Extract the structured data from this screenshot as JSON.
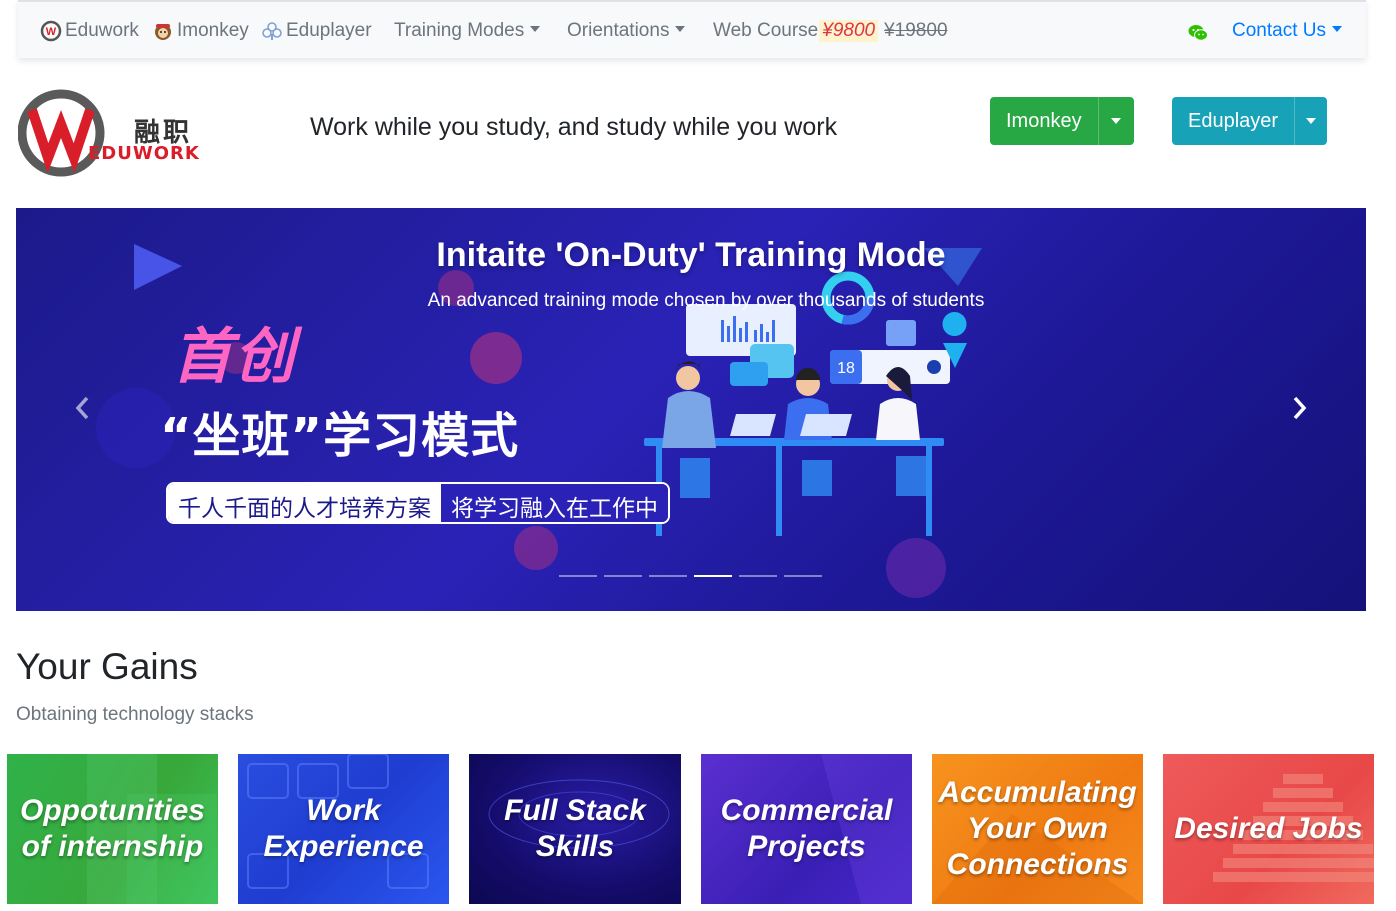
{
  "navbar": {
    "brand_items": [
      {
        "label": "Eduwork",
        "icon": "eduwork-logo-icon"
      },
      {
        "label": "Imonkey",
        "icon": "monkey-icon"
      },
      {
        "label": "Eduplayer",
        "icon": "eduplayer-icon"
      }
    ],
    "dropdowns": [
      "Training Modes",
      "Orientations"
    ],
    "web_course": {
      "label": "Web Course",
      "price_new": "¥9800",
      "price_old": "¥19800"
    },
    "wechat_icon": "wechat-icon",
    "contact": "Contact Us"
  },
  "header": {
    "logo_text_cn": "融职",
    "logo_text_en": "EDUWORK",
    "slogan": "Work while you study, and study while you work",
    "buttons": [
      {
        "label": "Imonkey",
        "color": "#28a745"
      },
      {
        "label": "Eduplayer",
        "color": "#17a2b8"
      }
    ]
  },
  "carousel": {
    "title": "Initaite 'On-Duty' Training Mode",
    "subtitle": "An advanced training mode chosen by over thousands of students",
    "banner_cn_1": "首创",
    "banner_cn_2": "“坐班”学习模式",
    "banner_cn_tag_left": "千人千面的人才培养方案",
    "banner_cn_tag_right": "将学习融入在工作中",
    "calendar_number": "18",
    "indicator_count": 6,
    "active_indicator": 3
  },
  "gains": {
    "title": "Your Gains",
    "subtitle": "Obtaining technology stacks",
    "cards": [
      {
        "label": "Oppotunities of internship",
        "color": "#2fb24a"
      },
      {
        "label": "Work Experience",
        "color": "#2a4ee0"
      },
      {
        "label": "Full Stack Skills",
        "color": "#140c6a"
      },
      {
        "label": "Commercial Projects",
        "color": "#4626c8"
      },
      {
        "label": "Accumulating Your Own Connections",
        "color": "#f7931e"
      },
      {
        "label": "Desired Jobs",
        "color": "#ef5a5a"
      }
    ]
  }
}
